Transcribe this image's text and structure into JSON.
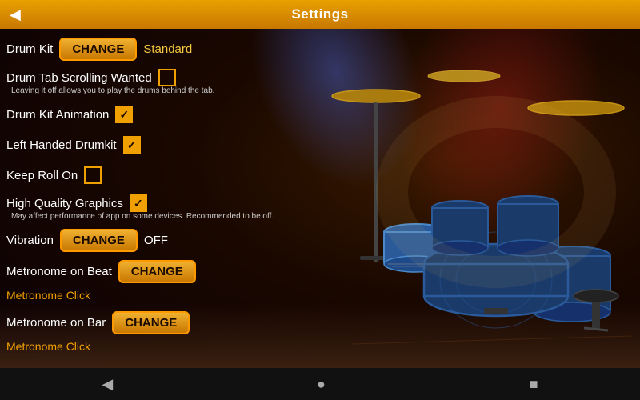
{
  "header": {
    "title": "Settings",
    "back_label": "◀"
  },
  "settings": {
    "drum_kit": {
      "label": "Drum Kit",
      "change_label": "CHANGE",
      "value": "Standard"
    },
    "drum_tab_scrolling": {
      "label": "Drum Tab Scrolling Wanted",
      "checked": false,
      "hint": "Leaving it off allows you to play the drums behind the tab."
    },
    "drum_kit_animation": {
      "label": "Drum Kit Animation",
      "checked": true
    },
    "left_handed": {
      "label": "Left Handed Drumkit",
      "checked": true
    },
    "keep_roll_on": {
      "label": "Keep Roll On",
      "checked": false
    },
    "high_quality_graphics": {
      "label": "High Quality Graphics",
      "checked": true,
      "hint": "May affect performance of app on some devices. Recommended to be off."
    },
    "vibration": {
      "label": "Vibration",
      "change_label": "CHANGE",
      "value": "OFF"
    },
    "metronome_beat": {
      "label": "Metronome on Beat",
      "change_label": "CHANGE",
      "link_label": "Metronome Click"
    },
    "metronome_bar": {
      "label": "Metronome on Bar",
      "change_label": "CHANGE",
      "link_label": "Metronome Click"
    }
  },
  "bottom_nav": {
    "back": "◀",
    "home": "●",
    "square": "■"
  }
}
